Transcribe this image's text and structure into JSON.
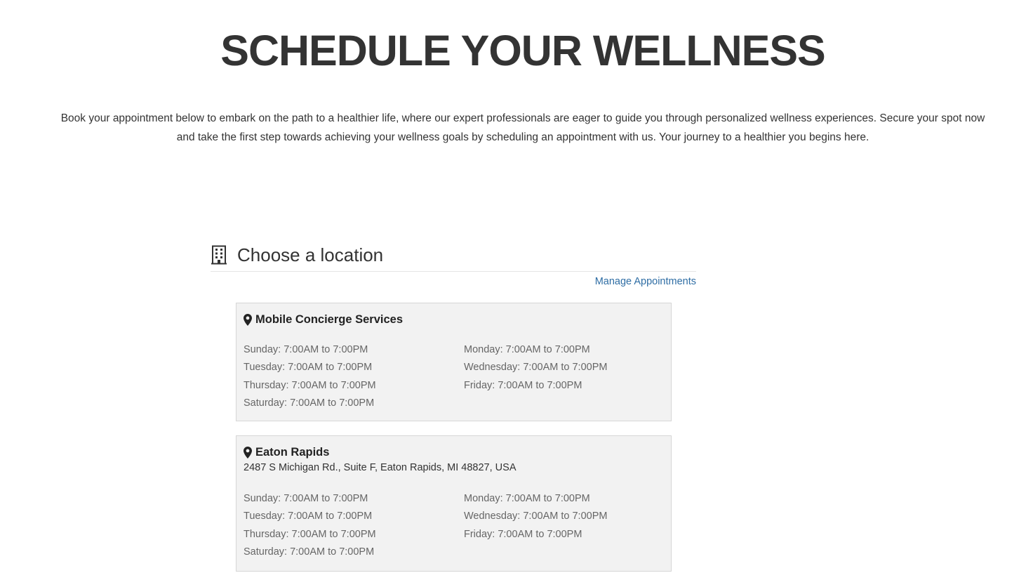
{
  "hero": {
    "title": "SCHEDULE YOUR WELLNESS",
    "intro_line1": "Book your appointment below to embark on the path to a healthier life, where our expert professionals are eager to guide you through personalized wellness experiences. Secure your spot now",
    "intro_line2": "and take the first step towards achieving your wellness goals by scheduling an appointment with us. Your journey to a healthier you begins here."
  },
  "section": {
    "icon": "building-icon",
    "title": "Choose a location",
    "manage_link": "Manage Appointments"
  },
  "locations": [
    {
      "icon": "map-pin-icon",
      "name": "Mobile Concierge Services",
      "address": "",
      "hours": [
        "Sunday: 7:00AM to 7:00PM",
        "Monday: 7:00AM to 7:00PM",
        "Tuesday: 7:00AM to 7:00PM",
        "Wednesday: 7:00AM to 7:00PM",
        "Thursday: 7:00AM to 7:00PM",
        "Friday: 7:00AM to 7:00PM",
        "Saturday: 7:00AM to 7:00PM"
      ]
    },
    {
      "icon": "map-pin-icon",
      "name": "Eaton Rapids",
      "address": "2487 S Michigan Rd., Suite F, Eaton Rapids, MI 48827, USA",
      "hours": [
        "Sunday: 7:00AM to 7:00PM",
        "Monday: 7:00AM to 7:00PM",
        "Tuesday: 7:00AM to 7:00PM",
        "Wednesday: 7:00AM to 7:00PM",
        "Thursday: 7:00AM to 7:00PM",
        "Friday: 7:00AM to 7:00PM",
        "Saturday: 7:00AM to 7:00PM"
      ]
    }
  ],
  "colors": {
    "text": "#333333",
    "link": "#2e6da4",
    "card_bg": "#f2f2f2",
    "card_border": "#d6d6d6",
    "hours_text": "#666666"
  }
}
